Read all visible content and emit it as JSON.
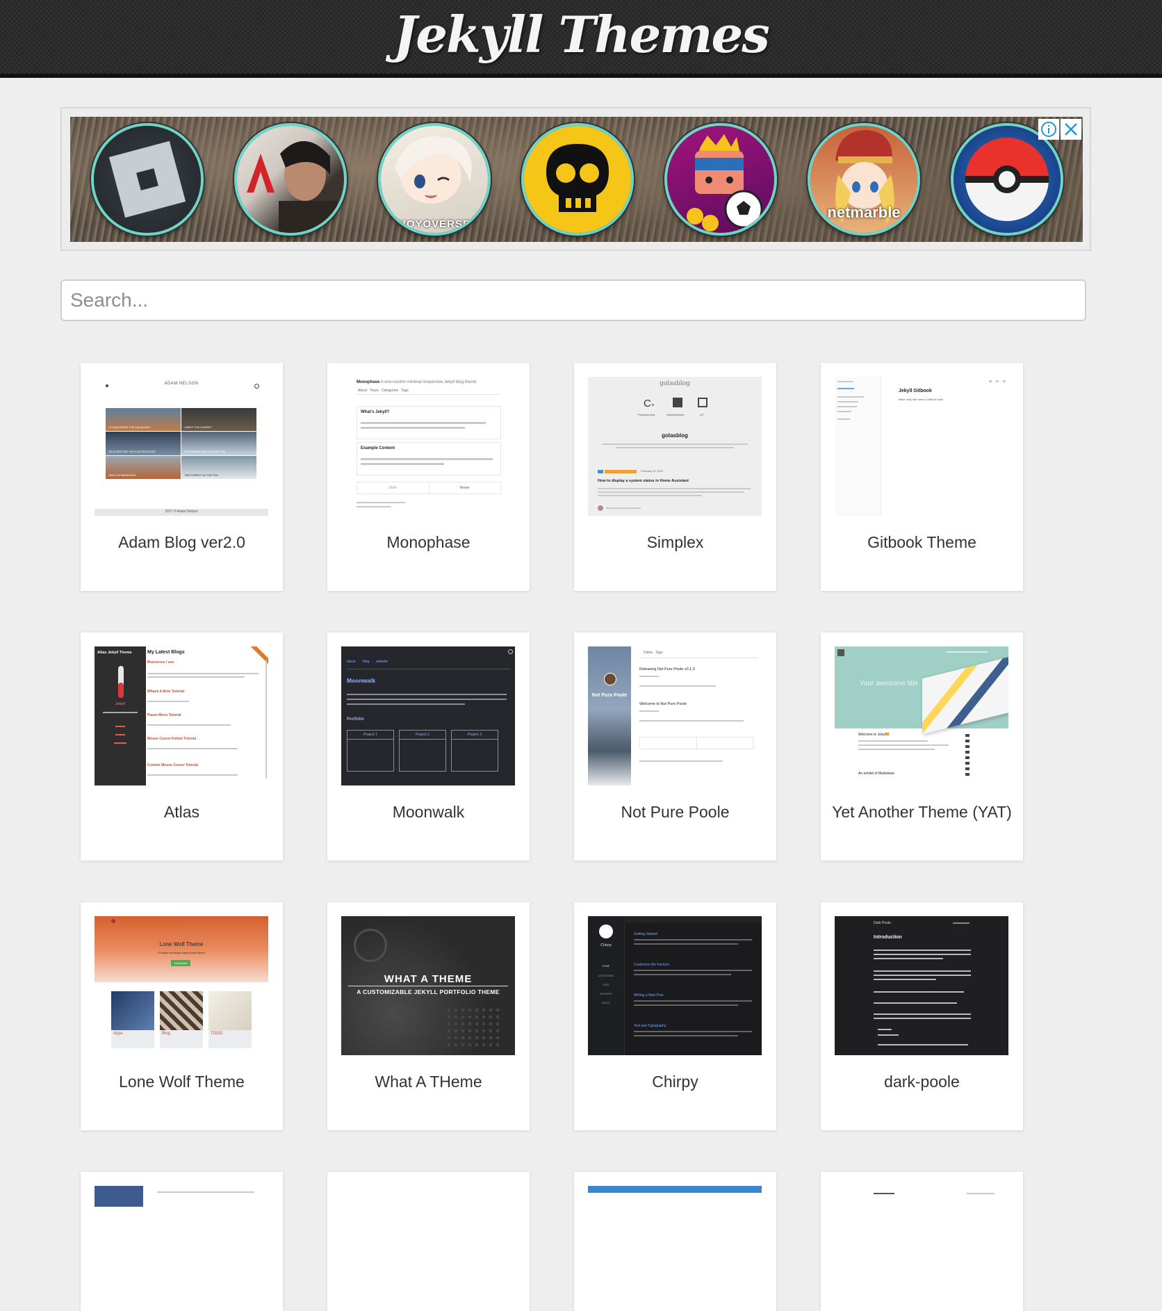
{
  "site": {
    "title": "Jekyll Themes"
  },
  "ad": {
    "info_icon": "info-icon",
    "close_icon": "close-icon",
    "games": [
      {
        "name": "roblox-icon"
      },
      {
        "name": "apex-legends-icon"
      },
      {
        "name": "genshin-impact-icon",
        "caption": "HOYOVERSE"
      },
      {
        "name": "brawl-stars-icon"
      },
      {
        "name": "soccer-game-icon"
      },
      {
        "name": "netmarble-game-icon",
        "caption": "netmarble"
      },
      {
        "name": "pokemon-go-icon"
      }
    ]
  },
  "search": {
    "placeholder": "Search..."
  },
  "themes": [
    {
      "title": "Adam Blog ver2.0",
      "thumb": {
        "header": "ADAM NELSON",
        "footer": "2017 © Adam Nelson",
        "tiles": [
          "I CONQUERED THE MALASOLE",
          "I MEET THE SUNSET",
          "ON A MEETING WITH ADVENTURES",
          "SNOWBOARDING ADVENTURE",
          "PAPA ON MEMORIES",
          "THE FOREST IN THE FOG"
        ]
      }
    },
    {
      "title": "Monophase",
      "thumb": {
        "brand": "Monophase",
        "tagline": "A one-column minimal responsive Jekyll blog theme",
        "nav": "About   Years   Categories   Tags",
        "post1": "What's Jekyll?",
        "post2": "Example Content",
        "older": "Older",
        "newer": "Newer"
      }
    },
    {
      "title": "Simplex",
      "thumb": {
        "header": "golasblog",
        "name": "golasblog",
        "cats": [
          "Programming",
          "Administration",
          "IoT"
        ],
        "post": "How to display a system status in Home Assistant",
        "date": "February 01, 2021"
      }
    },
    {
      "title": "Gitbook Theme",
      "thumb": {
        "heading": "Jekyll Gitbook",
        "sub": "Make Jelly site have a GitBook look!"
      }
    },
    {
      "title": "Atlas",
      "thumb": {
        "side": "Atlas Jekyll Theme",
        "heading": "My Latest Blogs",
        "brand": "Jekyll",
        "links": [
          "Resources I use",
          "Whack A Mole Tutorial",
          "Pause Menu Tutorial",
          "Mouse Cursor Follow Tutorial",
          "Custom Mouse Cursor Tutorial"
        ]
      }
    },
    {
      "title": "Moonwalk",
      "thumb": {
        "nav": [
          "about",
          "blog",
          "website"
        ],
        "heading": "Moonwalk",
        "section": "Portfolio",
        "projects": [
          "Project 1",
          "Project 2",
          "Project 3"
        ]
      }
    },
    {
      "title": "Not Pure Poole",
      "thumb": {
        "side": "Not Pure Poole",
        "tabs": "Dates   Tags",
        "post1": "Releasing Not Pure Poole v0.1.0",
        "post2": "Welcome to Not Pure Poole"
      }
    },
    {
      "title": "Yet Another Theme (YAT)",
      "thumb": {
        "hero": "Your awesome title",
        "post1": "Welcome to Jekyll!",
        "post2": "An exhibit of Markdown"
      }
    },
    {
      "title": "Lone Wolf Theme",
      "thumb": {
        "heading": "Lone Wolf Theme",
        "sub": "A simple bootstrap based jekyll theme",
        "button": "Download",
        "tiles": [
          "Apps",
          "Blog",
          "TODO"
        ]
      }
    },
    {
      "title": "What A THeme",
      "thumb": {
        "heading": "WHAT A THEME",
        "sub": "A CUSTOMIZABLE JEKYLL PORTFOLIO THEME"
      }
    },
    {
      "title": "Chirpy",
      "thumb": {
        "brand": "Chirpy",
        "nav": [
          "HOME",
          "CATEGORIES",
          "TAGS",
          "ARCHIVES",
          "ABOUT"
        ],
        "posts": [
          "Getting Started",
          "Customize the Favicon",
          "Writing a New Post",
          "Text and Typography"
        ]
      }
    },
    {
      "title": "dark-poole",
      "thumb": {
        "brand": "Dark Poole",
        "heading": "Introduction"
      }
    }
  ]
}
